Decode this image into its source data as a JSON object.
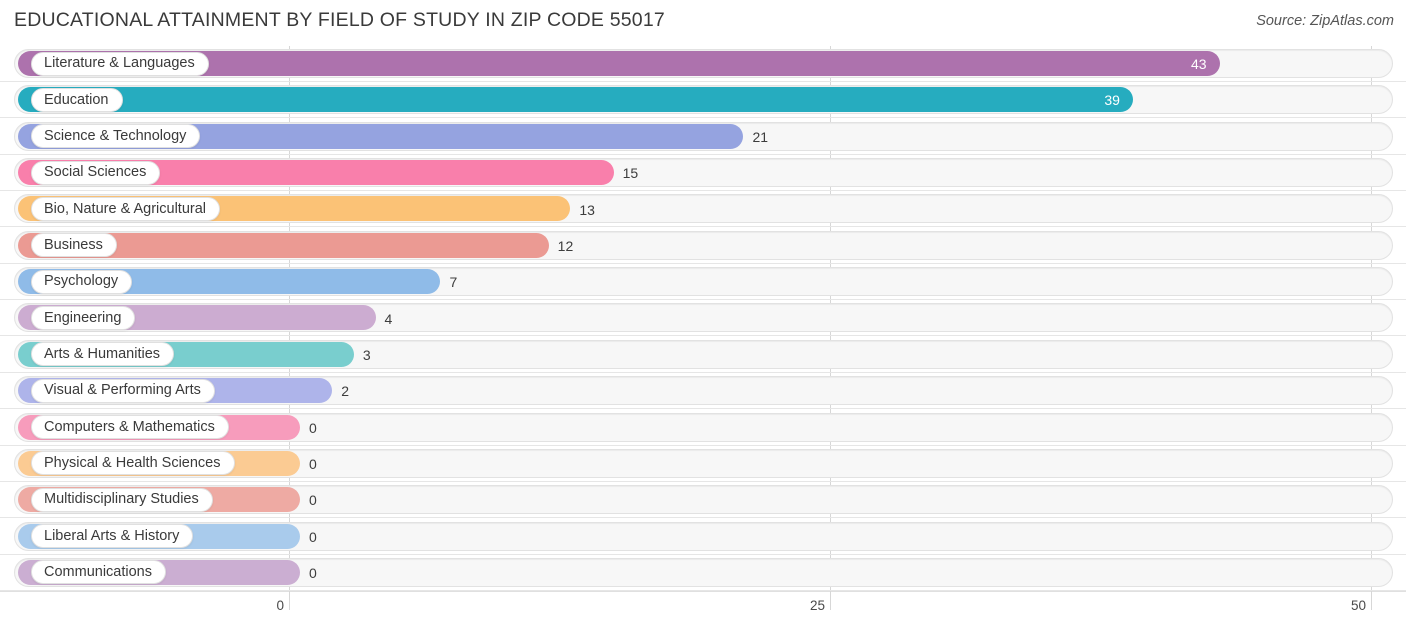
{
  "header": {
    "title": "EDUCATIONAL ATTAINMENT BY FIELD OF STUDY IN ZIP CODE 55017",
    "source": "Source: ZipAtlas.com"
  },
  "axis": {
    "ticks": [
      "0",
      "25",
      "50"
    ],
    "tick_values": [
      0,
      25,
      50
    ]
  },
  "chart_data": {
    "type": "bar",
    "orientation": "horizontal",
    "title": "EDUCATIONAL ATTAINMENT BY FIELD OF STUDY IN ZIP CODE 55017",
    "subtitle": "",
    "xlabel": "",
    "ylabel": "",
    "xlim": [
      0,
      50
    ],
    "xticks": [
      0,
      25,
      50
    ],
    "grid": true,
    "legend": false,
    "source": "Source: ZipAtlas.com",
    "categories": [
      "Literature & Languages",
      "Education",
      "Science & Technology",
      "Social Sciences",
      "Bio, Nature & Agricultural",
      "Business",
      "Psychology",
      "Engineering",
      "Arts & Humanities",
      "Visual & Performing Arts",
      "Computers & Mathematics",
      "Physical & Health Sciences",
      "Multidisciplinary Studies",
      "Liberal Arts & History",
      "Communications"
    ],
    "values": [
      43,
      39,
      21,
      15,
      13,
      12,
      7,
      4,
      3,
      2,
      0,
      0,
      0,
      0,
      0
    ],
    "value_labels": [
      "43",
      "39",
      "21",
      "15",
      "13",
      "12",
      "7",
      "4",
      "3",
      "2",
      "0",
      "0",
      "0",
      "0",
      "0"
    ],
    "colors": [
      "#ad72ad",
      "#26acbf",
      "#95a3e0",
      "#f97fab",
      "#fbc276",
      "#eb9a93",
      "#8fbbe8",
      "#ccacd1",
      "#79cece",
      "#aeb4ea",
      "#f79cbc",
      "#fbcb93",
      "#eeaaa3",
      "#a9cbec",
      "#cbaed2"
    ]
  }
}
